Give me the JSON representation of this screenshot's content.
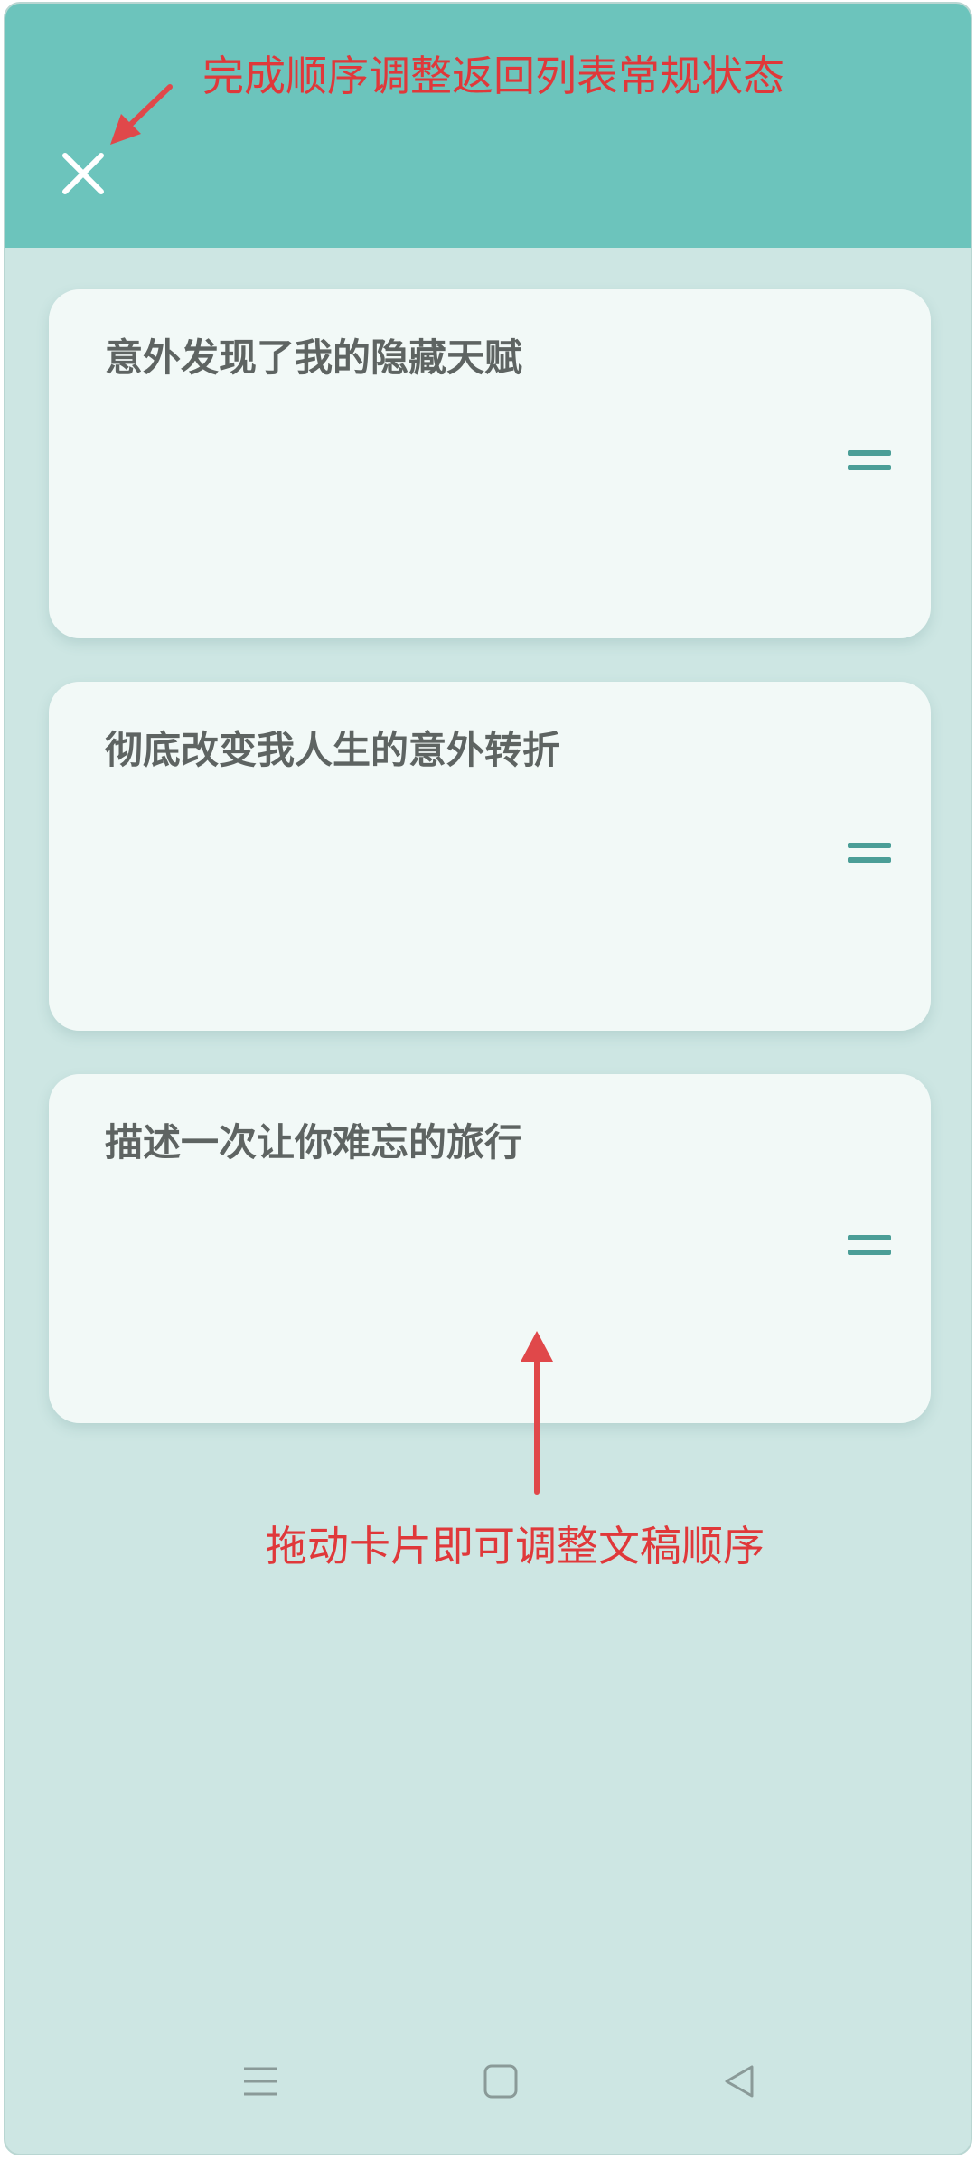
{
  "header": {
    "close_icon": "close-icon",
    "background_color": "#6cc4bc"
  },
  "annotations": {
    "top_note": "完成顺序调整返回列表常规状态",
    "bottom_note": "拖动卡片即可调整文稿顺序",
    "color": "#e0383a"
  },
  "cards": [
    {
      "title": "意外发现了我的隐藏天赋",
      "handle_icon": "drag-handle-icon"
    },
    {
      "title": "彻底改变我人生的意外转折",
      "handle_icon": "drag-handle-icon"
    },
    {
      "title": "描述一次让你难忘的旅行",
      "handle_icon": "drag-handle-icon"
    }
  ],
  "navbar": {
    "menu_icon": "menu-icon",
    "home_icon": "home-icon",
    "back_icon": "back-icon"
  }
}
